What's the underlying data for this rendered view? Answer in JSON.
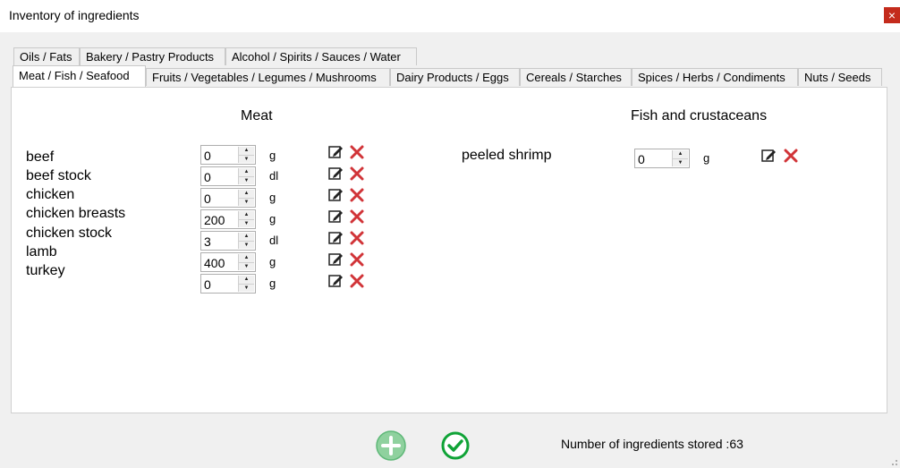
{
  "window": {
    "title": "Inventory of ingredients",
    "close_label": "×"
  },
  "tabs": {
    "row1": [
      "Oils / Fats",
      "Bakery / Pastry Products",
      "Alcohol / Spirits / Sauces / Water"
    ],
    "row2": [
      "Meat / Fish / Seafood",
      "Fruits / Vegetables / Legumes / Mushrooms",
      "Dairy Products / Eggs",
      "Cereals / Starches",
      "Spices / Herbs / Condiments",
      "Nuts / Seeds"
    ],
    "active": "Meat / Fish / Seafood"
  },
  "meat": {
    "heading": "Meat",
    "items": [
      {
        "name": "beef",
        "value": "0",
        "unit": "g"
      },
      {
        "name": "beef stock",
        "value": "0",
        "unit": "dl"
      },
      {
        "name": "chicken",
        "value": "0",
        "unit": "g"
      },
      {
        "name": "chicken breasts",
        "value": "200",
        "unit": "g"
      },
      {
        "name": "chicken stock",
        "value": "3",
        "unit": "dl"
      },
      {
        "name": "lamb",
        "value": "400",
        "unit": "g"
      },
      {
        "name": "turkey",
        "value": "0",
        "unit": "g"
      }
    ]
  },
  "fish": {
    "heading": "Fish and crustaceans",
    "items": [
      {
        "name": "peeled shrimp",
        "value": "0",
        "unit": "g"
      }
    ]
  },
  "footer": {
    "counter": "Number of ingredients stored :63"
  },
  "icons": {
    "edit": "edit-icon",
    "delete": "delete-icon",
    "add": "add-circle-icon",
    "confirm": "check-circle-icon"
  },
  "colors": {
    "delete": "#d13438",
    "add": "#8fd19e",
    "confirm": "#10a337"
  }
}
